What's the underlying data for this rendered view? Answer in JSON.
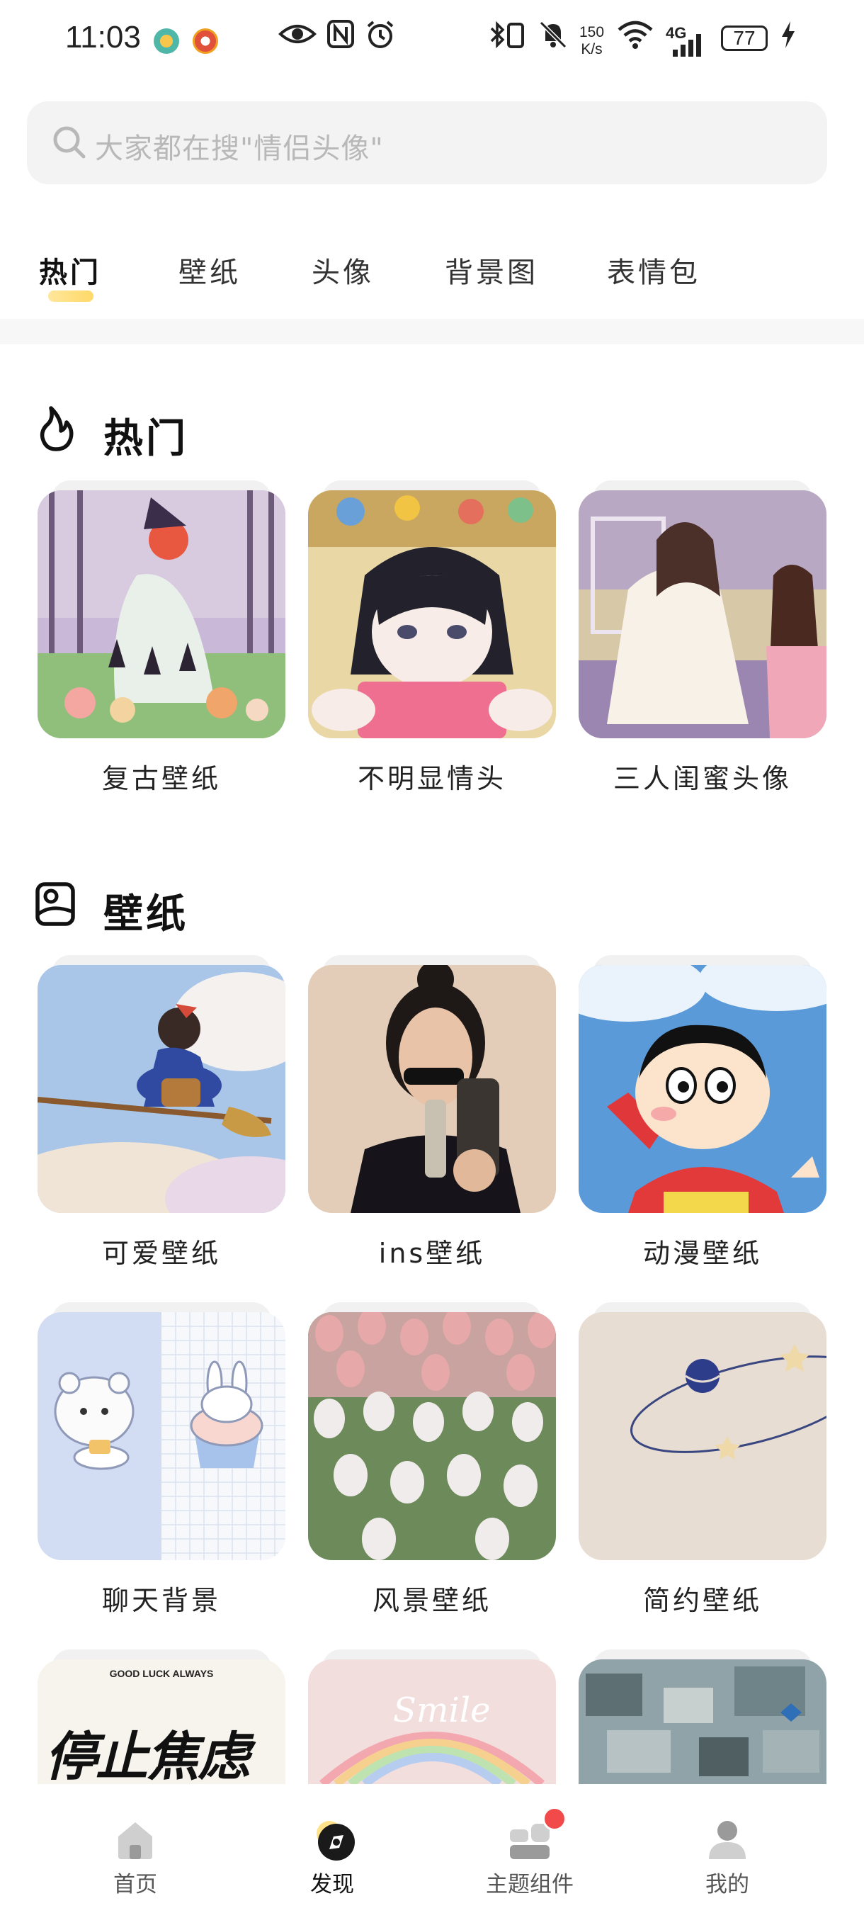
{
  "status_bar": {
    "time": "11:03",
    "speed_top": "150",
    "speed_bottom": "K/s",
    "network": "4G",
    "battery": "77",
    "icons": [
      "eye-icon",
      "nfc-icon",
      "alarm-icon",
      "bluetooth-icon",
      "vibrate-icon",
      "mute-icon",
      "wifi-icon",
      "signal-icon",
      "charging-icon"
    ]
  },
  "search": {
    "placeholder": "大家都在搜\"情侣头像\""
  },
  "tabs": [
    {
      "label": "热门",
      "active": true
    },
    {
      "label": "壁纸",
      "active": false
    },
    {
      "label": "头像",
      "active": false
    },
    {
      "label": "背景图",
      "active": false
    },
    {
      "label": "表情包",
      "active": false
    }
  ],
  "sections": {
    "hot": {
      "title": "热门",
      "icon": "flame-icon",
      "items": [
        {
          "label": "复古壁纸"
        },
        {
          "label": "不明显情头"
        },
        {
          "label": "三人闺蜜头像"
        }
      ]
    },
    "wallpaper": {
      "title": "壁纸",
      "icon": "picture-icon",
      "items": [
        {
          "label": "可爱壁纸"
        },
        {
          "label": "ins壁纸"
        },
        {
          "label": "动漫壁纸"
        },
        {
          "label": "聊天背景"
        },
        {
          "label": "风景壁纸"
        },
        {
          "label": "简约壁纸"
        }
      ],
      "partial_items": [
        {
          "caption_line1": "GOOD LUCK ALWAYS",
          "caption_line2": "停止焦虑"
        },
        {
          "caption_line1": "Smile"
        },
        {
          "caption_line1": ""
        }
      ]
    }
  },
  "bottom_nav": [
    {
      "label": "首页",
      "icon": "home-icon",
      "active": false
    },
    {
      "label": "发现",
      "icon": "discover-icon",
      "active": true
    },
    {
      "label": "主题组件",
      "icon": "widgets-icon",
      "active": false,
      "badge": true
    },
    {
      "label": "我的",
      "icon": "profile-icon",
      "active": false
    }
  ],
  "colors": {
    "accent": "#ffd24d",
    "badge": "#f24a4a",
    "search_bg": "#f3f3f3",
    "placeholder": "#b8b8b8"
  }
}
